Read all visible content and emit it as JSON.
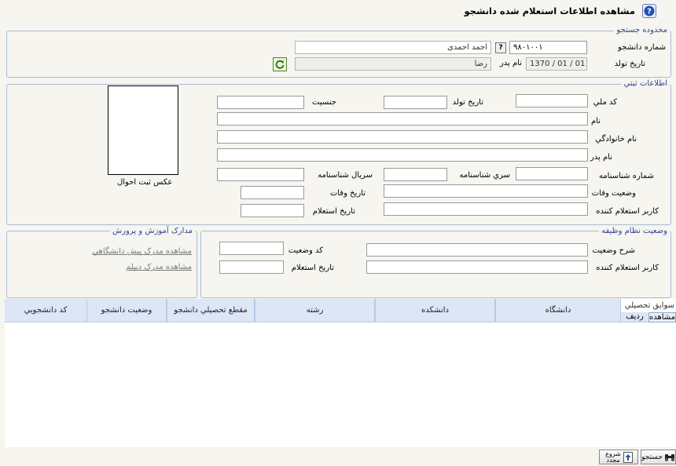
{
  "header": {
    "title": "مشاهده اطلاعات استعلام شده دانشجو",
    "help_icon": "question-circle-icon"
  },
  "search": {
    "legend": "محدوده جستجو",
    "student_no_label": "شماره دانشجو",
    "student_no_value": "۹۸۰۱۰۰۱",
    "student_name_value": "احمد  احمدی",
    "lookup_button": "?",
    "birthdate_label": "تاریخ تولد",
    "birthdate_value": "1370 / 01 / 01",
    "father_label": "نام پدر",
    "father_value": "رضا",
    "refresh_icon": "refresh-icon"
  },
  "registry": {
    "legend": "اطلاعات ثبتي",
    "national_code": "کد ملي",
    "birthdate": "تاريخ تولد",
    "gender": "جنسيت",
    "first_name": "نام",
    "last_name": "نام خانوادگي",
    "father_name": "نام پدر",
    "id_number": "شماره شناسنامه",
    "id_series": "سري شناسنامه",
    "id_serial": "سريال شناسنامه",
    "death_status": "وضعيت وفات",
    "death_date": "تاريخ وفات",
    "inquiry_user": "کاربر استعلام کننده",
    "inquiry_date": "تاريخ استعلام",
    "photo_caption": "عكس ثبت احوال"
  },
  "education": {
    "legend": "مدارک آموزش و پرورش",
    "preuniversity_link": "مشاهده مدرک پيش دانشگاهي",
    "diploma_link": "مشاهده مدرک ديپلم"
  },
  "military": {
    "legend": "وضعيت نظام وظيفه",
    "status_desc": "شرح وضعيت",
    "status_code": "کد وضعيت",
    "inquiry_user": "کاربر استعلام کننده",
    "inquiry_date": "تاريخ استعلام"
  },
  "history": {
    "title": "سوابق تحصيلي",
    "columns": [
      "مشاهده",
      "رديف",
      "دانشگاه",
      "دانشکده",
      "رشته",
      "مقطع تحصيلي دانشجو",
      "وضعيت دانشجو",
      "کد دانشجويي"
    ],
    "rows": []
  },
  "footer": {
    "search_button": "جستجو",
    "restart_button": "شروع مجدد",
    "search_icon": "binoculars-icon",
    "restart_icon": "restart-icon"
  },
  "colors": {
    "legend": "#33449a",
    "frame": "#aabbd4",
    "table_header": "#dce6f6"
  }
}
